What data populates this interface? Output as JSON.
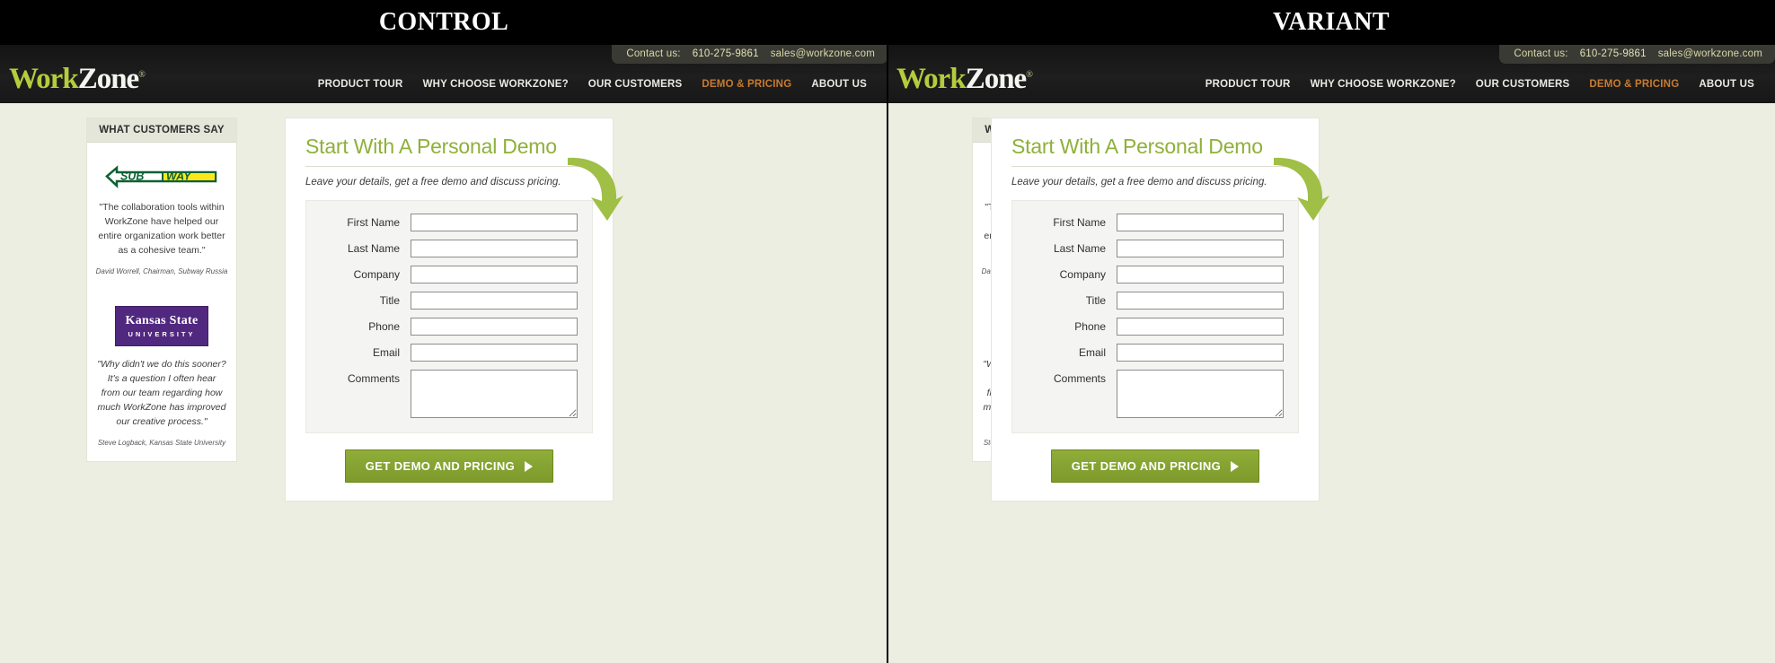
{
  "panels": [
    {
      "caption": "CONTROL"
    },
    {
      "caption": "VARIANT"
    }
  ],
  "site": {
    "contact": {
      "label": "Contact us:",
      "phone": "610-275-9861",
      "email": "sales@workzone.com"
    },
    "logo": {
      "part1": "Work",
      "part2": "Zone",
      "tm": "®"
    },
    "nav": [
      {
        "label": "PRODUCT TOUR",
        "active": false
      },
      {
        "label": "WHY CHOOSE WORKZONE?",
        "active": false
      },
      {
        "label": "OUR CUSTOMERS",
        "active": false
      },
      {
        "label": "DEMO & PRICING",
        "active": true
      },
      {
        "label": "ABOUT US",
        "active": false
      }
    ]
  },
  "testimonials": {
    "header": "WHAT CUSTOMERS SAY",
    "items": [
      {
        "logo_name": "subway-logo",
        "logo_text_1": "SUB",
        "logo_text_2": "WAY",
        "quote": "\"The collaboration tools within WorkZone have helped our entire organization work better\nas a cohesive team.\"",
        "attrib": "David Worrell, Chairman, Subway Russia"
      },
      {
        "logo_name": "kansas-state-university-logo",
        "logo_text_1": "Kansas State",
        "logo_text_2": "UNIVERSITY",
        "quote": "\"Why didn't we do this sooner? It's a question I often hear from our team regarding how much WorkZone has improved our creative process.\"",
        "attrib": "Steve Logback, Kansas State University"
      }
    ]
  },
  "form": {
    "title": "Start With A Personal Demo",
    "subtitle": "Leave your details, get a free demo and discuss pricing.",
    "fields": [
      {
        "label": "First Name",
        "type": "text",
        "value": ""
      },
      {
        "label": "Last Name",
        "type": "text",
        "value": ""
      },
      {
        "label": "Company",
        "type": "text",
        "value": ""
      },
      {
        "label": "Title",
        "type": "text",
        "value": ""
      },
      {
        "label": "Phone",
        "type": "text",
        "value": ""
      },
      {
        "label": "Email",
        "type": "text",
        "value": ""
      },
      {
        "label": "Comments",
        "type": "textarea",
        "value": ""
      }
    ],
    "submit_label": "GET DEMO AND PRICING"
  },
  "colors": {
    "brand_green": "#8fb03a",
    "logo_green": "#b5cc3c",
    "nav_active": "#c77b30",
    "page_bg": "#eceee1",
    "header_bg": "#1a1a1a",
    "ksu_purple": "#51287f",
    "subway_yellow": "#ffe81a",
    "subway_green": "#0b6132",
    "button_green": "#8fad38"
  }
}
